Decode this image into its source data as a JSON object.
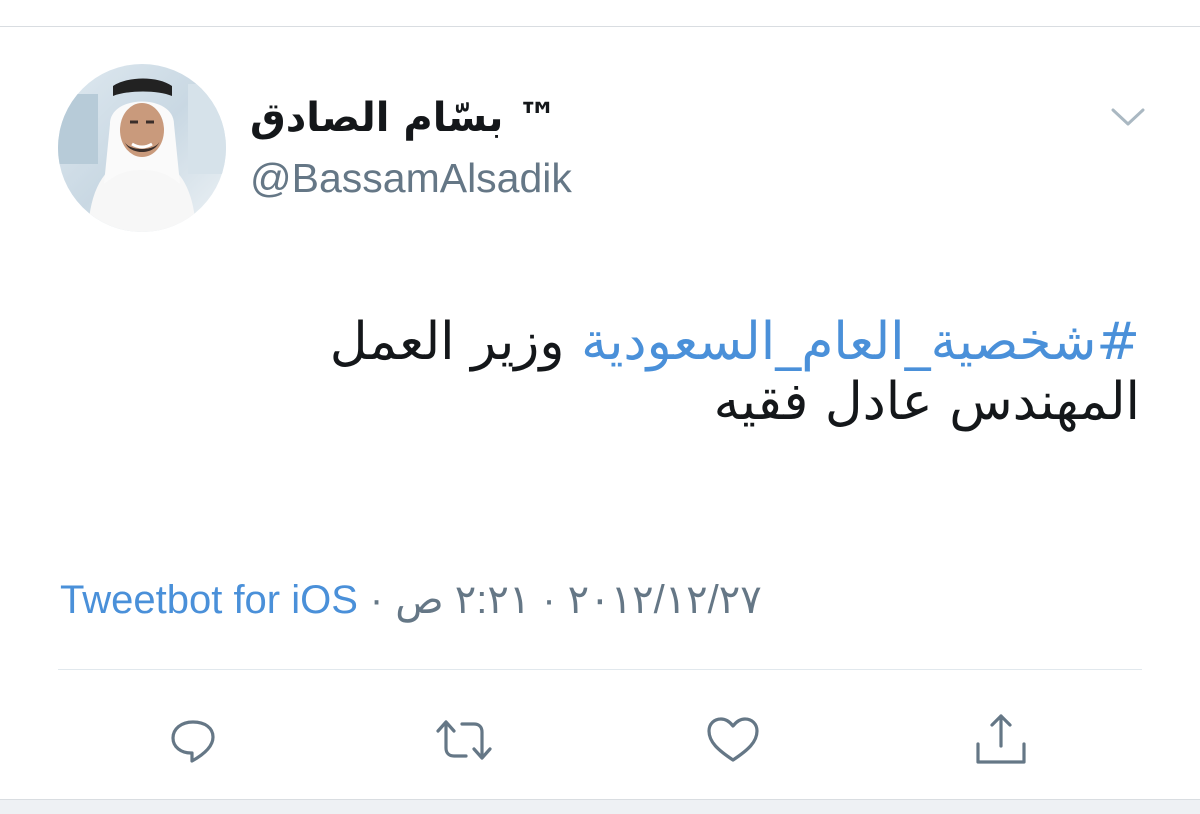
{
  "author": {
    "display_name": "بسّام الصادق ™",
    "username": "@BassamAlsadik"
  },
  "tweet": {
    "hashtag": "#شخصية_العام_السعودية",
    "line1_rest": " وزير العمل",
    "line2": "المهندس عادل فقيه"
  },
  "meta": {
    "time": "٢:٢١ ص",
    "date": "٢٠١٢/١٢/٢٧",
    "separator": "·",
    "source": "Tweetbot for iOS"
  },
  "actions": {
    "reply_icon": "reply-icon",
    "retweet_icon": "retweet-icon",
    "like_icon": "heart-icon",
    "share_icon": "share-icon"
  },
  "colors": {
    "link": "#4a90d9",
    "text": "#14171a",
    "muted": "#657786",
    "icon": "#657786"
  }
}
